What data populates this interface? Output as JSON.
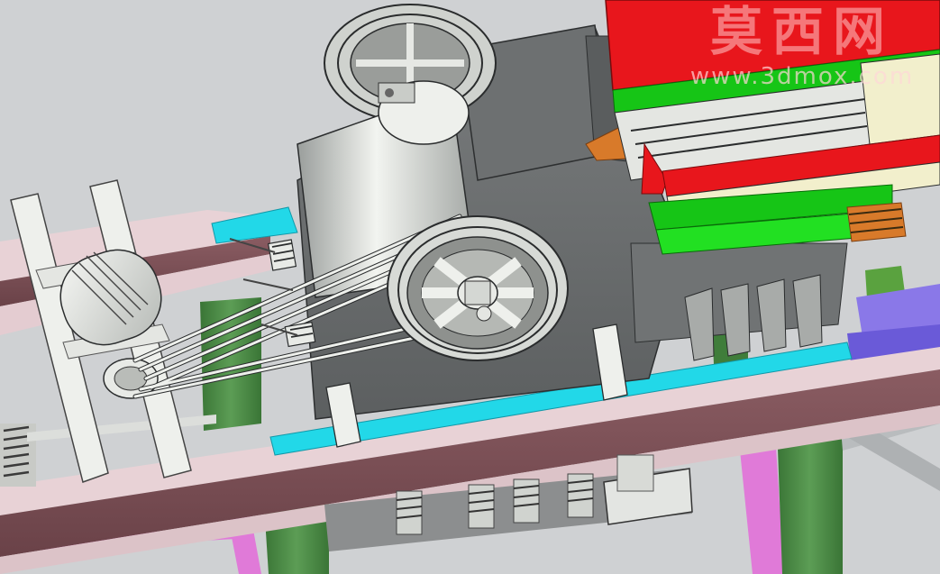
{
  "watermark": {
    "title": "莫西网",
    "url": "www.3dmox.com"
  },
  "colors": {
    "background": "#c9cbce",
    "frame_rail": "#7a4f55",
    "frame_rail_top": "#e8d2d6",
    "leg_green": "#4a8a44",
    "mount_cyan": "#22d8e8",
    "hopper_red": "#e8161c",
    "hopper_green": "#16c516",
    "hopper_cream": "#f2efcc",
    "body_grey": "#686b6c",
    "part_light": "#e6e8e4",
    "purple_base": "#8a78e8",
    "spring_orange": "#d87a2a"
  },
  "icons": [
    "motor-icon",
    "flywheel-icon",
    "belt-pulley-icon",
    "spring-icon"
  ]
}
